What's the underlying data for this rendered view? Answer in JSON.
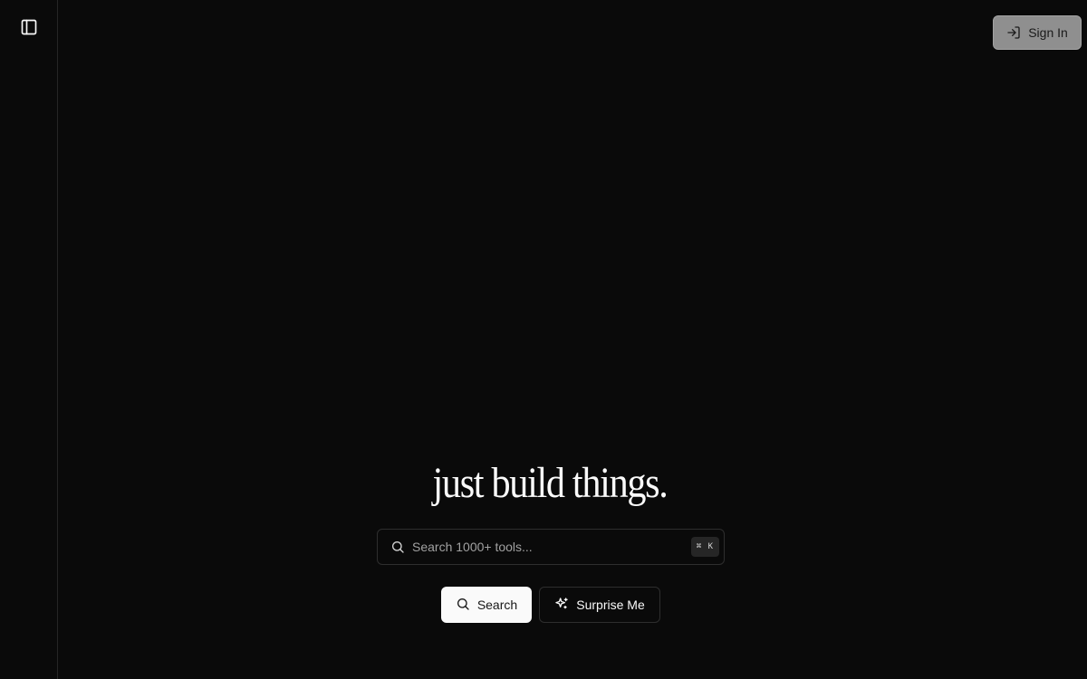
{
  "sidebar": {
    "toggle_icon": "panel-left-icon"
  },
  "header": {
    "signin_label": "Sign In",
    "signin_icon": "log-in-icon"
  },
  "hero": {
    "headline": "just build things.",
    "search": {
      "placeholder": "Search 1000+ tools...",
      "value": "",
      "shortcut": "⌘ K",
      "icon": "search-icon"
    },
    "search_button_label": "Search",
    "surprise_button_label": "Surprise Me",
    "surprise_icon": "sparkles-icon"
  },
  "colors": {
    "background": "#0a0a0a",
    "border": "#2e2e2e",
    "primary_button": "#fafafa",
    "signin_button": "#8f8f8f"
  }
}
